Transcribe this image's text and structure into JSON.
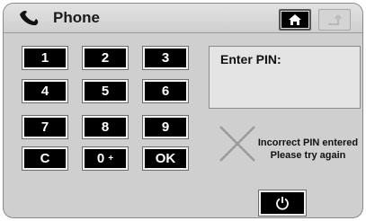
{
  "header": {
    "title": "Phone",
    "phone_icon": "handset-icon",
    "home_icon": "home-icon",
    "back_icon": "back-arrow-icon"
  },
  "keypad": {
    "keys": [
      {
        "label": "1",
        "sub": ""
      },
      {
        "label": "2",
        "sub": ""
      },
      {
        "label": "3",
        "sub": ""
      },
      {
        "label": "4",
        "sub": ""
      },
      {
        "label": "5",
        "sub": ""
      },
      {
        "label": "6",
        "sub": ""
      },
      {
        "label": "7",
        "sub": ""
      },
      {
        "label": "8",
        "sub": ""
      },
      {
        "label": "9",
        "sub": ""
      },
      {
        "label": "C",
        "sub": ""
      },
      {
        "label": "0",
        "sub": "+"
      },
      {
        "label": "OK",
        "sub": ""
      }
    ]
  },
  "pin": {
    "label": "Enter PIN:",
    "value": ""
  },
  "status": {
    "line1": "Incorrect PIN entered",
    "line2": "Please try again",
    "icon": "error-x-icon"
  },
  "power": {
    "icon": "power-icon"
  },
  "colors": {
    "background": "#cfcfcf",
    "key_bg": "#000000",
    "key_text": "#ffffff"
  }
}
